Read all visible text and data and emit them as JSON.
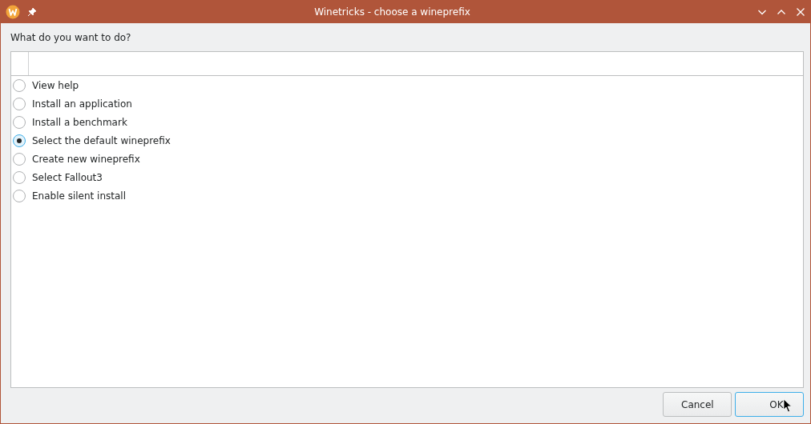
{
  "window": {
    "title": "Winetricks - choose a wineprefix"
  },
  "prompt": "What do you want to do?",
  "options": [
    {
      "label": "View help",
      "selected": false
    },
    {
      "label": "Install an application",
      "selected": false
    },
    {
      "label": "Install a benchmark",
      "selected": false
    },
    {
      "label": "Select the default wineprefix",
      "selected": true
    },
    {
      "label": "Create new wineprefix",
      "selected": false
    },
    {
      "label": "Select Fallout3",
      "selected": false
    },
    {
      "label": "Enable silent install",
      "selected": false
    }
  ],
  "buttons": [
    {
      "label": "Cancel",
      "focused": false
    },
    {
      "label": "OK",
      "focused": true
    }
  ]
}
